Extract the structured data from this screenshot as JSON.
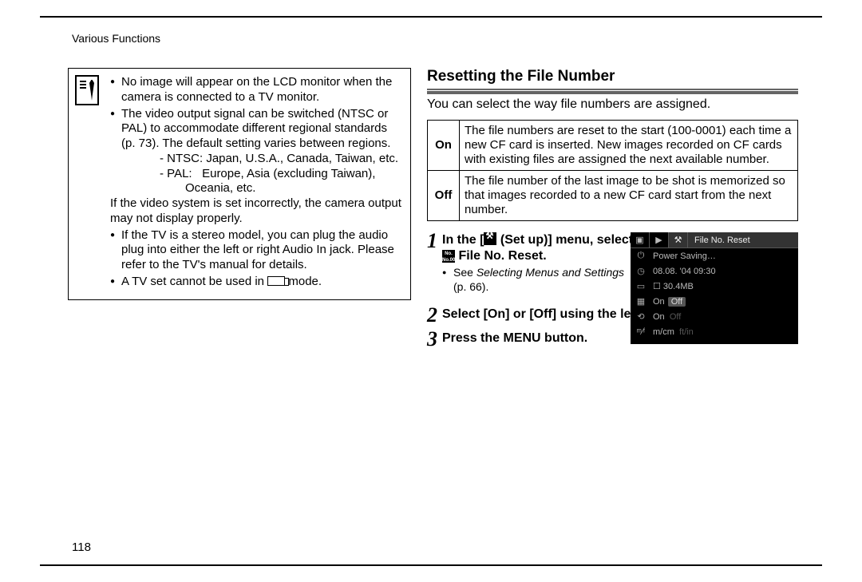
{
  "header": "Various Functions",
  "page_number": "118",
  "left": {
    "b1": "No image will appear on the LCD monitor when the camera is connected to a TV monitor.",
    "b2": "The video output signal can be switched (NTSC or PAL) to accommodate different regional standards (p. 73). The default setting varies between regions.",
    "ntsc_label": "NTSC:",
    "ntsc_val": "Japan, U.S.A., Canada, Taiwan, etc.",
    "pal_label": "PAL:",
    "pal_val": "Europe, Asia (excluding Taiwan), Oceania, etc.",
    "b2_tail": "If the video system is set incorrectly, the camera output may not display properly.",
    "b3": "If the TV is a stereo model, you can plug the audio plug into either the left or right Audio In jack. Please refer to the TV's manual for details.",
    "b4_pre": "A TV set cannot be used in ",
    "b4_post": " mode."
  },
  "right": {
    "title": "Resetting the File Number",
    "intro": "You can select the way file numbers are assigned.",
    "table": {
      "on_key": "On",
      "on_val": "The file numbers are reset to the start (100-0001) each time a new CF card is inserted. New images recorded on CF cards with existing files are assigned the next available number.",
      "off_key": "Off",
      "off_val": "The file number of the last image to be shot is memorized so that images recorded to a new CF card start from the next number."
    },
    "steps": {
      "s1_a": "In the [",
      "s1_b": " (Set up)] menu, select ",
      "s1_c": " File No. Reset.",
      "s1_note_a": "See ",
      "s1_note_em": "Selecting Menus and Settings",
      "s1_note_b": " (p. 66).",
      "s2": "Select [On] or [Off] using the left or right button.",
      "s3": "Press the MENU button."
    },
    "lcd": {
      "title": "File No. Reset",
      "r1": "Power Saving…",
      "r2": "08.08. '04 09:30",
      "r3": "☐ 30.4MB",
      "r4a": "On",
      "r4b": "Off",
      "r5a": "On",
      "r5b_dim": "Off",
      "r6a": "m/cm",
      "r6b_dim": "ft/in"
    }
  }
}
